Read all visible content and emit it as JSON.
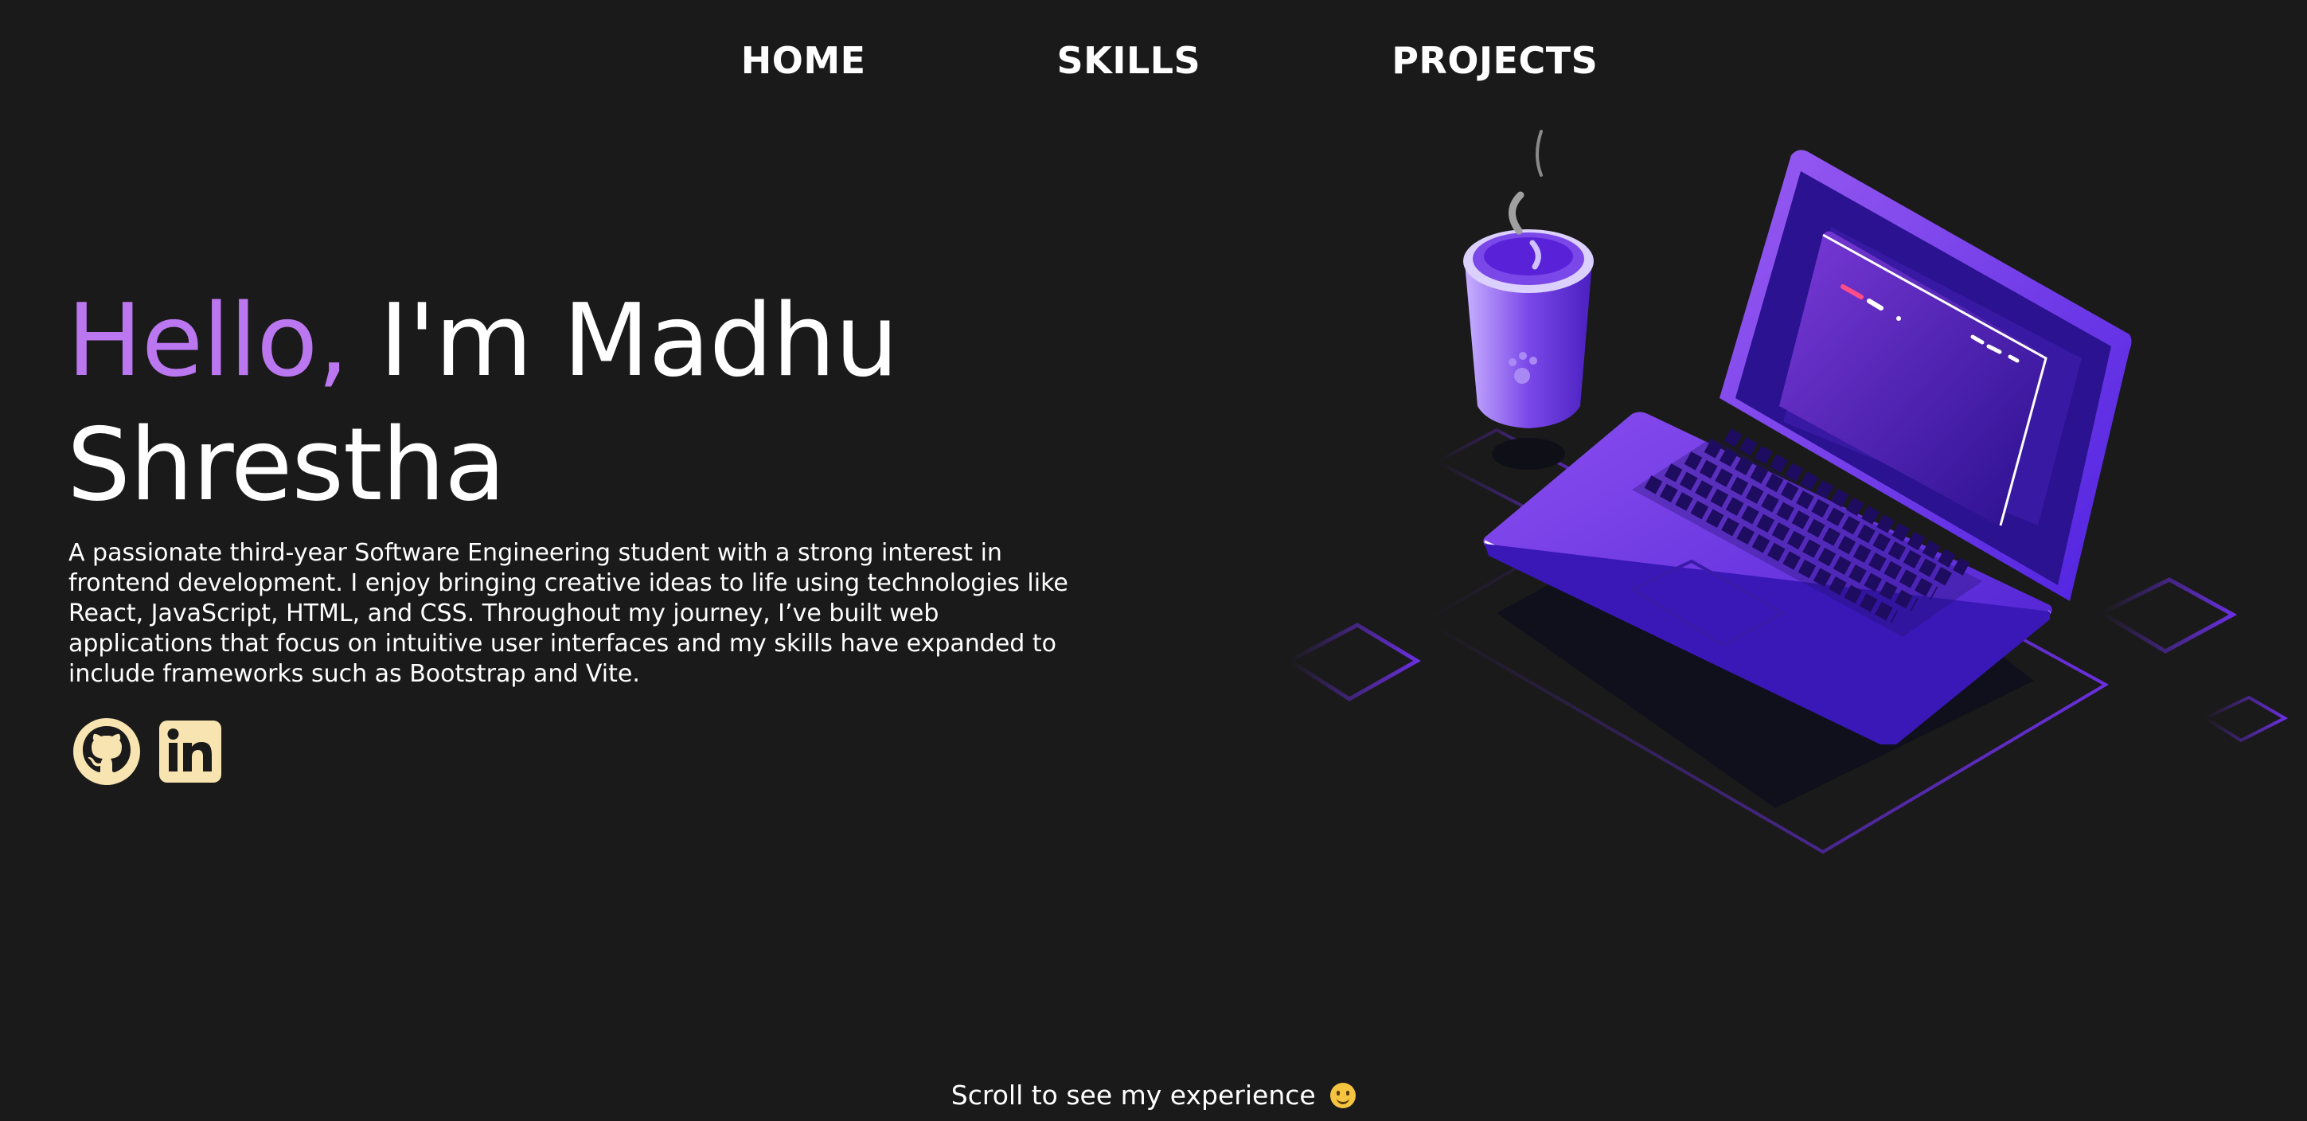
{
  "nav": {
    "items": [
      {
        "label": "HOME"
      },
      {
        "label": "SKILLS"
      },
      {
        "label": "PROJECTS"
      }
    ]
  },
  "hero": {
    "greeting": "Hello,",
    "name_part": " I'm Madhu Shrestha",
    "description": "A passionate third-year Software Engineering student with a strong interest in frontend development. I enjoy bringing creative ideas to life using technologies like React, JavaScript, HTML, and CSS. Throughout my journey, I’ve built web applications that focus on intuitive user interfaces and my skills have expanded to include frameworks such as Bootstrap and Vite."
  },
  "socials": [
    {
      "icon": "github-icon"
    },
    {
      "icon": "linkedin-icon"
    }
  ],
  "illustration": {
    "icon": "laptop-coffee-illustration"
  },
  "footer": {
    "scroll_hint": "Scroll to see my experience",
    "emoji": "smiling-face-emoji"
  },
  "colors": {
    "background": "#1a1a1a",
    "accent": "#bb77f0",
    "social_icon": "#f8e4b0",
    "illustration_purple": "#6a2fe0"
  }
}
